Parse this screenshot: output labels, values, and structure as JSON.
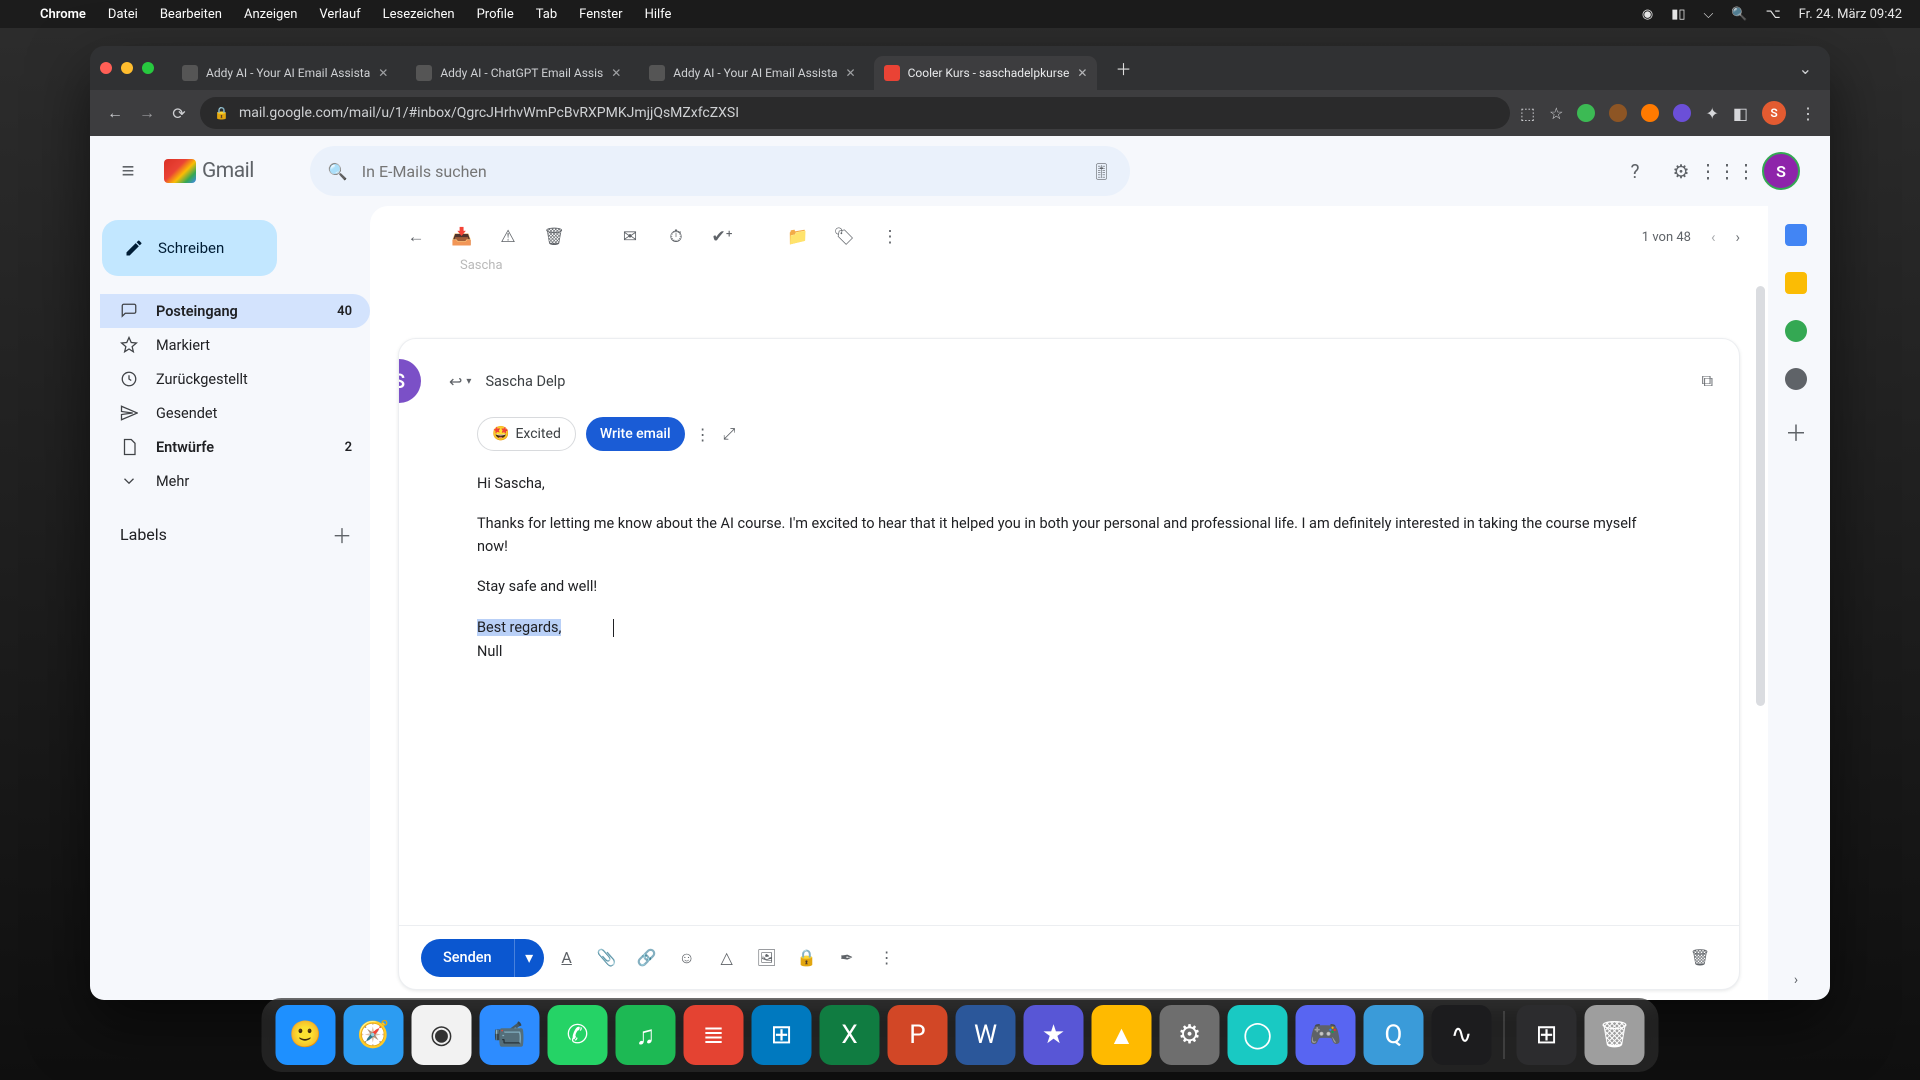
{
  "menubar": {
    "app": "Chrome",
    "items": [
      "Datei",
      "Bearbeiten",
      "Anzeigen",
      "Verlauf",
      "Lesezeichen",
      "Profile",
      "Tab",
      "Fenster",
      "Hilfe"
    ],
    "clock": "Fr. 24. März  09:42"
  },
  "browser": {
    "tabs": [
      {
        "title": "Addy AI - Your AI Email Assista"
      },
      {
        "title": "Addy AI - ChatGPT Email Assis"
      },
      {
        "title": "Addy AI - Your AI Email Assista"
      },
      {
        "title": "Cooler Kurs - saschadelpkurse"
      }
    ],
    "active_tab_index": 3,
    "url": "mail.google.com/mail/u/1/#inbox/QgrcJHrhvWmPcBvRXPMKJmjjQsMZxfcZXSI"
  },
  "gmail": {
    "product": "Gmail",
    "search_placeholder": "In E-Mails suchen",
    "compose": "Schreiben",
    "nav": {
      "inbox": {
        "label": "Posteingang",
        "count": "40"
      },
      "starred": {
        "label": "Markiert"
      },
      "snoozed": {
        "label": "Zurückgestellt"
      },
      "sent": {
        "label": "Gesendet"
      },
      "drafts": {
        "label": "Entwürfe",
        "count": "2"
      },
      "more": {
        "label": "Mehr"
      },
      "labels_header": "Labels"
    },
    "pager": {
      "text": "1 von 48"
    },
    "ghost_sender": "Sascha",
    "compose_card": {
      "recipient": "Sascha Delp",
      "tone_chip": "Excited",
      "write_btn": "Write email",
      "body": {
        "greeting": "Hi Sascha,",
        "para1": "Thanks for letting me know about the AI course. I'm excited to hear that it helped you in both your personal and professional life. I am definitely interested in taking the course myself now!",
        "para2": "Stay safe and well!",
        "closing_selected": "Best regards,",
        "signature": "Null"
      },
      "send": "Senden"
    },
    "account_initial": "S"
  },
  "dock": [
    {
      "name": "finder",
      "bg": "#1e90ff"
    },
    {
      "name": "safari",
      "bg": "#2c9cf2"
    },
    {
      "name": "chrome",
      "bg": "#f2f2f2"
    },
    {
      "name": "zoom",
      "bg": "#2d8cff"
    },
    {
      "name": "whatsapp",
      "bg": "#25d366"
    },
    {
      "name": "spotify",
      "bg": "#1db954"
    },
    {
      "name": "todoist",
      "bg": "#e44332"
    },
    {
      "name": "trello",
      "bg": "#0079bf"
    },
    {
      "name": "excel",
      "bg": "#107c41"
    },
    {
      "name": "powerpoint",
      "bg": "#d24726"
    },
    {
      "name": "word",
      "bg": "#2b579a"
    },
    {
      "name": "imovie",
      "bg": "#5856d6"
    },
    {
      "name": "drive",
      "bg": "#ffba00"
    },
    {
      "name": "settings",
      "bg": "#6e6e6e"
    },
    {
      "name": "siri",
      "bg": "#19c9c3"
    },
    {
      "name": "discord",
      "bg": "#5865f2"
    },
    {
      "name": "quicktime",
      "bg": "#3a9bd9"
    },
    {
      "name": "voice-memos",
      "bg": "#1c1c1e"
    },
    {
      "name": "mission-control",
      "bg": "#2c2c2e"
    },
    {
      "name": "trash",
      "bg": "#9e9e9e"
    }
  ],
  "colors": {
    "gmail_accent": "#0b57d0",
    "compose_bg": "#c2e7ff",
    "nav_active": "#d3e3fd"
  }
}
